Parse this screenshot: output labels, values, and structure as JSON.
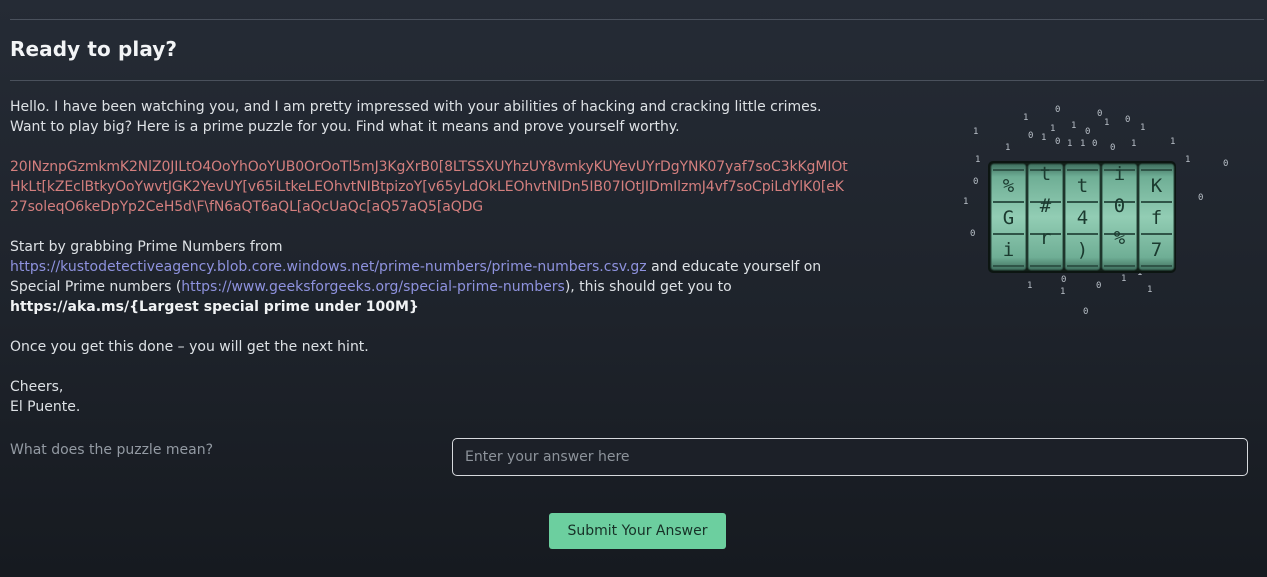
{
  "header": {
    "title": "Ready to play?"
  },
  "intro": {
    "line1": "Hello. I have been watching you, and I am pretty impressed with your abilities of hacking and cracking little crimes.",
    "line2": "Want to play big? Here is a prime puzzle for you. Find what it means and prove yourself worthy."
  },
  "cipher": {
    "line1": "20INznpGzmkmK2NlZ0JILtO4OoYhOoYUB0OrOoTl5mJ3KgXrB0[8LTSSXUYhzUY8vmkyKUYevUYrDgYNK07yaf7soC3kKgMIOt",
    "line2": "HkLt[kZEclBtkyOoYwvtJGK2YevUY[v65iLtkeLEOhvtNIBtpizoY[v65yLdOkLEOhvtNIDn5IB07IOtJIDmIlzmJ4vf7soCpiLdYlK0[eK",
    "line3": "27soleqO6keDpYp2CeH5d\\F\\fN6aQT6aQL[aQcUaQc[aQ57aQ5[aQDG"
  },
  "instructions": {
    "start": "Start by grabbing Prime Numbers from",
    "primes_url": "https://kustodetectiveagency.blob.core.windows.net/prime-numbers/prime-numbers.csv.gz",
    "educate": "and educate yourself on",
    "special_prefix": "Special Prime numbers (",
    "special_url": "https://www.geeksforgeeks.org/special-prime-numbers",
    "special_suffix": "), this should get you to",
    "target_url": "https://aka.ms/{Largest special prime under 100M}",
    "next_hint": "Once you get this done – you will get the next hint."
  },
  "signoff": {
    "greeting": "Cheers,",
    "name": "El Puente."
  },
  "form": {
    "question": "What does the puzzle mean?",
    "placeholder": "Enter your answer here",
    "submit_label": "Submit Your Answer"
  },
  "illustration": {
    "icon": "cryptex-lock-icon",
    "wheel_chars": [
      [
        "%",
        "G",
        "i"
      ],
      [
        "t",
        "#",
        "r"
      ],
      [
        "t",
        "4",
        ")"
      ],
      [
        "i",
        "0",
        "%"
      ],
      [
        "K",
        "f",
        "7"
      ]
    ]
  },
  "colors": {
    "accent": "#6ccf9f",
    "cipher_text": "#d47f7e",
    "link": "#8e92de",
    "background": "#1e232b"
  }
}
